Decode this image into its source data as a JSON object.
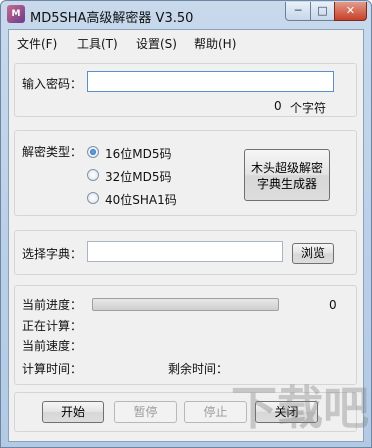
{
  "window": {
    "title": "MD5SHA高级解密器 V3.50",
    "icon_label": "M",
    "controls": {
      "minimize": "─",
      "maximize": "□",
      "close": "✕"
    }
  },
  "menu": [
    "文件(F)",
    "工具(T)",
    "设置(S)",
    "帮助(H)"
  ],
  "password": {
    "label": "输入密码：",
    "value": "",
    "count_value": "0",
    "count_unit": "个字符"
  },
  "decrypt_type": {
    "label": "解密类型：",
    "options": [
      "16位MD5码",
      "32位MD5码",
      "40位SHA1码"
    ],
    "selected_index": 0,
    "generator_button": [
      "木头超级解密",
      "字典生成器"
    ]
  },
  "dictionary": {
    "label": "选择字典：",
    "value": "",
    "browse_button": "浏览"
  },
  "status": {
    "progress_label": "当前进度：",
    "progress_value": "0",
    "progress_fraction": 0,
    "computing_label": "正在计算：",
    "speed_label": "当前速度：",
    "elapsed_label": "计算时间：",
    "remaining_label": "剩余时间："
  },
  "buttons": {
    "start": "开始",
    "pause": "暂停",
    "stop": "停止",
    "close": "关闭"
  },
  "watermark": "下载吧"
}
